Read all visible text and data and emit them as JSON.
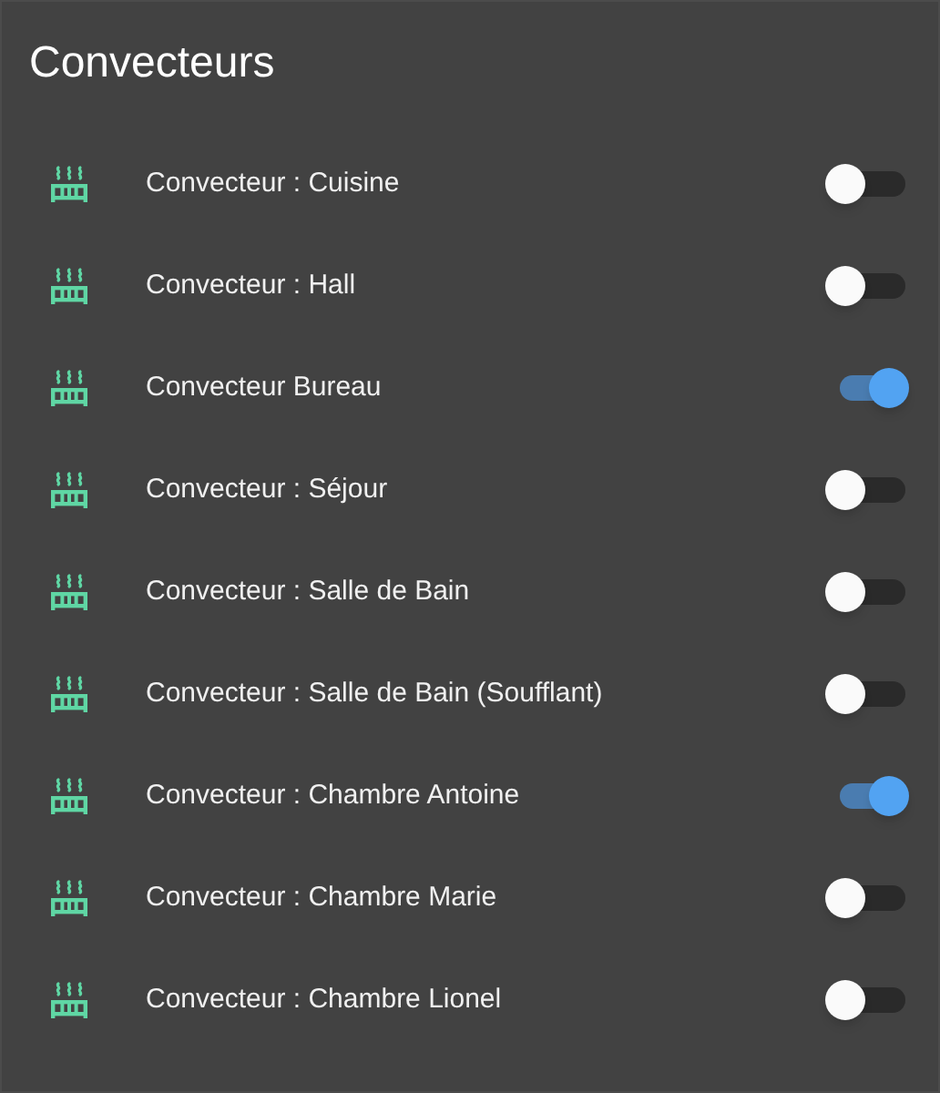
{
  "title": "Convecteurs",
  "rows": [
    {
      "label": "Convecteur : Cuisine",
      "on": false
    },
    {
      "label": "Convecteur : Hall",
      "on": false
    },
    {
      "label": "Convecteur Bureau",
      "on": true
    },
    {
      "label": "Convecteur : Séjour",
      "on": false
    },
    {
      "label": "Convecteur : Salle de Bain",
      "on": false
    },
    {
      "label": "Convecteur : Salle de Bain (Soufflant)",
      "on": false
    },
    {
      "label": "Convecteur : Chambre Antoine",
      "on": true
    },
    {
      "label": "Convecteur : Chambre Marie",
      "on": false
    },
    {
      "label": "Convecteur : Chambre Lionel",
      "on": false
    }
  ]
}
